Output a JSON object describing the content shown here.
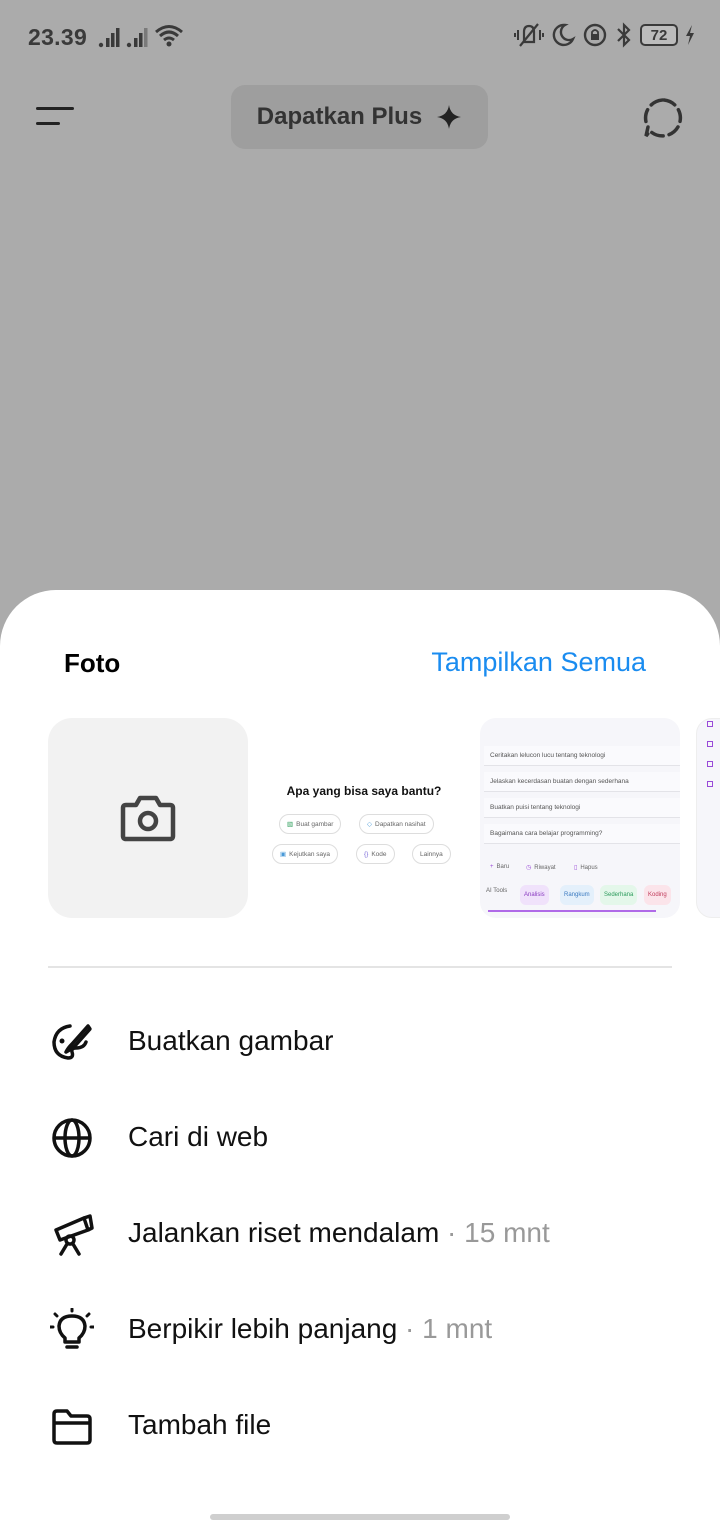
{
  "status_bar": {
    "time": "23.39",
    "battery": "72"
  },
  "top_bar": {
    "plus_label": "Dapatkan Plus"
  },
  "sheet": {
    "section_title": "Foto",
    "show_all": "Tampilkan Semua",
    "thumb1": {
      "title": "Apa yang bisa saya bantu?",
      "chips": [
        "Buat gambar",
        "Dapatkan nasihat",
        "Kejutkan saya",
        "Kode",
        "Lainnya"
      ]
    },
    "thumb2": {
      "rows": [
        "Ceritakan lelucon lucu tentang teknologi",
        "Jelaskan kecerdasan buatan dengan sederhana",
        "Buatkan puisi tentang teknologi",
        "Bagaimana cara belajar programming?"
      ],
      "buttons": [
        "Baru",
        "Riwayat",
        "Hapus"
      ],
      "tools_label": "AI Tools",
      "tags": [
        "Analisis",
        "Rangkum",
        "Sederhana",
        "Koding"
      ]
    },
    "actions": [
      {
        "label": "Buatkan gambar",
        "meta": "",
        "icon": "palette-brush-icon"
      },
      {
        "label": "Cari di web",
        "meta": "",
        "icon": "globe-icon"
      },
      {
        "label": "Jalankan riset mendalam",
        "meta": " · 15 mnt",
        "icon": "telescope-icon"
      },
      {
        "label": "Berpikir lebih panjang",
        "meta": " · 1 mnt",
        "icon": "lightbulb-icon"
      },
      {
        "label": "Tambah file",
        "meta": "",
        "icon": "folder-icon"
      }
    ]
  },
  "colors": {
    "accent": "#1a8cf0",
    "overlay": "#ababab",
    "sheet": "#ffffff"
  }
}
